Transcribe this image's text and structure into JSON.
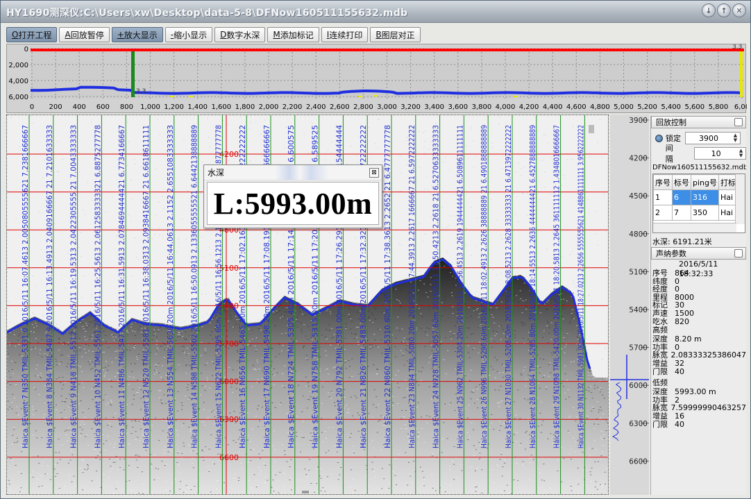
{
  "window": {
    "title": "HY1690测深仪:C:\\Users\\xw\\Desktop\\data-5-8\\DFNow160511155632.mdb",
    "buttons": [
      "↓",
      "↑",
      "✕"
    ]
  },
  "toolbar": [
    {
      "key": "O",
      "label": "打开工程",
      "pressed": true
    },
    {
      "key": "A",
      "label": "回放暂停",
      "pressed": false
    },
    {
      "key": "+",
      "label": "放大显示",
      "pressed": true
    },
    {
      "key": "-",
      "label": "缩小显示",
      "pressed": false
    },
    {
      "key": "D",
      "label": "数字水深",
      "pressed": false
    },
    {
      "key": "M",
      "label": "添加标记",
      "pressed": false
    },
    {
      "key": "I",
      "label": "连续打印",
      "pressed": false
    },
    {
      "key": "B",
      "label": "图层对正",
      "pressed": false
    }
  ],
  "overview": {
    "y_ticks": [
      "0",
      "2,000",
      "4,000",
      "6,000"
    ],
    "x_ticks": [
      "0",
      "200",
      "400",
      "600",
      "800",
      "1,000",
      "1,200",
      "1,400",
      "1,600",
      "1,800",
      "2,000",
      "2,200",
      "2,400",
      "2,600",
      "2,800",
      "3,000",
      "3,200",
      "3,400",
      "3,600",
      "3,800",
      "4,000",
      "4,200",
      "4,400",
      "4,600",
      "4,800",
      "5,000",
      "5,200",
      "5,400",
      "5,600",
      "5,800",
      "6,00"
    ],
    "marker_label": "3,3",
    "corner_label": "3,3",
    "colors": {
      "line": "#1f2fe0",
      "top": "#ff0000",
      "cursor": "#1a8a1a",
      "dots": "#e8e800"
    }
  },
  "sonar": {
    "events": [
      "Haica $Event 7 N350 TMIL-5331.0 2016/5/11 16:07.4613 2.0050805555621 7.2381666667",
      "Haica $Event 8 N384 TMIL-5487.9 2016/5/11 16:13.4913 2.0409166667 21 7.2101633333",
      "Haica $Event 9 N418 TMIL-5512 2016/5/11 16:19.5313 2.0422305555 21 7.0043333333",
      "Haica $Event 10 N452 TMIL-5561 2016/5/11 16:25.5613 2.0612583333321 6.8875277778",
      "Haica $Event 11 N486 TMIL-5477 2016/5/11 16:31.5913 2.0784694444421 6.7734166667",
      "Haica $Event 12 N520 TMIL-5581 2016/5/11 16:38.0313 2.0938416667 21 6.6618611111",
      "Haica $Event 13 N554 TMIL-5638.20m 2016/5/11 16:44.0613 2.1152 2.6551083333333",
      "Haica $Event 14 N588 TMIL-5502 2016/5/11 16:50.0913 2.1336055555521 6.6442138888889",
      "Haica $Event 15 N622 TMIL-5295.60m 2016/5/11 16:56.1213 2.1533416667 21 6.3877777778",
      "Haica $Event 16 N656 TMIL-5465.80m 2016/5/11 17:02.1613 2.1723 21 6.2222222222",
      "Haica $Event 17 N690 TMIL-5498.20m 2016/5/11 17:08.1913 2.1875 21 6.6666666667",
      "Haica $Event 18 N724 TMIL-5305.40m 2016/5/11 17:14.2213 2.1952 21 6.600575",
      "Haica $Event 19 N758 TMIL-5315.00m 2016/5/11 17:20.2513 2.2041 21 6.589525",
      "Haica $Event 20 N792 TMIL-5381.00m 2016/5/11 17:26.2913 2.2452 21 6.5154444444",
      "Haica $Event 21 N826 TMIL-5483.00m 2016/5/11 17:32.3213 2.2661 21 6.4722222222",
      "Haica $Event 22 N860 TMIL-5310.60m 2016/5/11 17:38.3613 2.2652 21 6.4777777778",
      "Haica $Event 23 N894 TMIL-5080.20m 2016/5/11 17:44.3913 2.2617 1666667 21 6.5972222222",
      "Haica $Event 24 N928 TMIL-5057.80m 2016/5/11 17:50.4213 2.2618 21 6.5270633333333",
      "Haica $Event 25 N962 TMIL-5304.20m 2016/5/11 17:56.4513 2.2619 1944444421 6.5089611111111",
      "Haica $Event 26 N996 TMIL-5290.60m 2016/5/11 18:02.4913 2.2626 38888889 21 6.4901888888889",
      "Haica $Event 27 N1030 TMIL-5208.20m 2016/5/11 18:08.5213 2.2628 33333333 21 6.4713972222222",
      "Haica $Event 28 N1064 TMIL-5285.80m 2016/5/11 18:14.5513 2.2636 4444444421 6.4527888888889",
      "Haica $Event 29 N1098 TMIL-5420.00m 2016/5/11 18:20.5813 2.2645 361111112 1.4348016666667",
      "Haica $Event 30 N1132 TMIL-5981.00m 2016/5/11 18:27.0213 2.2656 5555555621 4148861111111 3.9562222222"
    ],
    "depth_labels": [
      "4200",
      "4500",
      "4800",
      "5100",
      "5400",
      "5700",
      "6000",
      "6300",
      "6600"
    ],
    "colors": {
      "grid": "#e00000",
      "event": "#1a8f1a",
      "text": "#1f2fd0",
      "bottom": "#1f2fe0"
    }
  },
  "depth_scale": [
    "3900",
    "4200",
    "4500",
    "4800",
    "5100",
    "5400",
    "5700",
    "6000",
    "6300",
    "6600"
  ],
  "popup": {
    "title": "水深",
    "value": "L:5993.00m",
    "close": "⊠"
  },
  "panel": {
    "replay_header": "回放控制",
    "lock_label": "锁定",
    "lock_value": "3900",
    "interval_label": "间隔",
    "interval_value": "10",
    "db_name": "DFNow160511155632.mdb",
    "table": {
      "headers": [
        "序号",
        "标号",
        "ping号",
        "打标"
      ],
      "rows": [
        [
          "1",
          "6",
          "316",
          "Hai"
        ],
        [
          "2",
          "7",
          "350",
          "Hai"
        ]
      ]
    },
    "depth_reading": "水深:  6191.21米",
    "sonar_header": "声纳参数",
    "timestamp": "2016/5/11 18:32:33",
    "params": [
      {
        "k": "序号",
        "v": "864"
      },
      {
        "k": "纬度",
        "v": "0"
      },
      {
        "k": "经度",
        "v": "0"
      },
      {
        "k": "里程",
        "v": "8000"
      },
      {
        "k": "标记",
        "v": "30"
      },
      {
        "k": "声速",
        "v": "1500"
      },
      {
        "k": "吃水",
        "v": "820"
      }
    ],
    "high_label": "高频",
    "high": [
      {
        "k": "深度",
        "v": "8.20 m"
      },
      {
        "k": "功率",
        "v": "0"
      },
      {
        "k": "脉宽",
        "v": "2.08333325386047"
      },
      {
        "k": "增益",
        "v": "32"
      },
      {
        "k": "门限",
        "v": "40"
      }
    ],
    "low_label": "低频",
    "low": [
      {
        "k": "深度",
        "v": "5993.00 m"
      },
      {
        "k": "功率",
        "v": "2"
      },
      {
        "k": "脉宽",
        "v": "7.59999990463257"
      },
      {
        "k": "增益",
        "v": "16"
      },
      {
        "k": "门限",
        "v": "40"
      }
    ]
  }
}
